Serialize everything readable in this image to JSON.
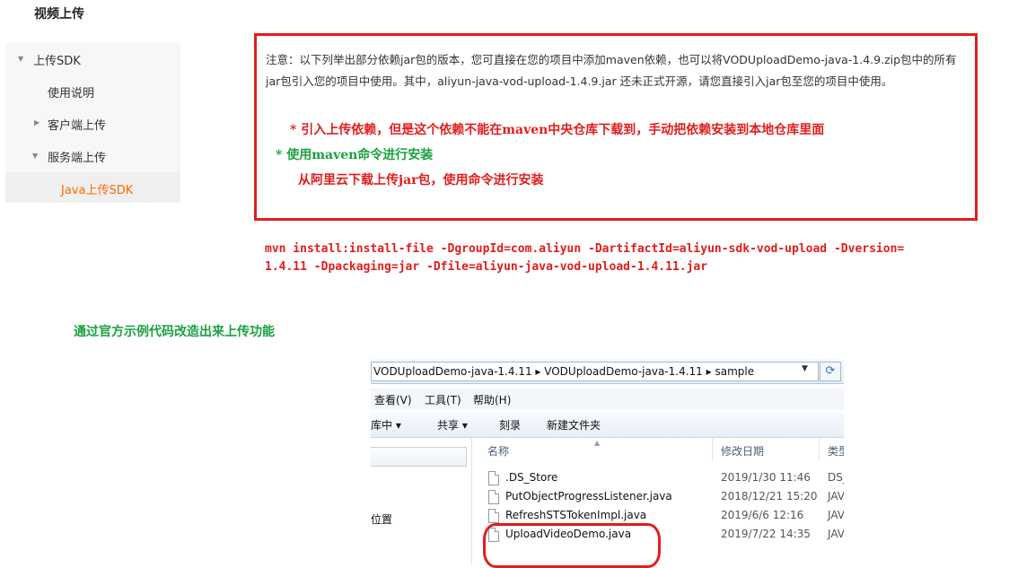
{
  "page_title": "视频上传",
  "sidebar": {
    "items": [
      {
        "label": "上传SDK"
      },
      {
        "label": "使用说明"
      },
      {
        "label": "客户端上传"
      },
      {
        "label": "服务端上传"
      },
      {
        "label": "Java上传SDK"
      }
    ]
  },
  "notice": {
    "text": "注意：以下列举出部分依赖jar包的版本，您可直接在您的项目中添加maven依赖，也可以将VODUploadDemo-java-1.4.9.zip包中的所有jar包引入您的项目中使用。其中，aliyun-java-vod-upload-1.4.9.jar 还未正式开源，请您直接引入jar包至您的项目中使用。",
    "annotation1": "* 引入上传依赖，但是这个依赖不能在maven中央仓库下载到，手动把依赖安装到本地仓库里面",
    "annotation2": "* 使用maven命令进行安装",
    "annotation3": "从阿里云下载上传jar包，使用命令进行安装"
  },
  "mvn_command": {
    "line1": "mvn install:install-file -DgroupId=com.aliyun -DartifactId=aliyun-sdk-vod-upload -Dversion=",
    "line2": "1.4.11 -Dpackaging=jar -Dfile=aliyun-java-vod-upload-1.4.11.jar"
  },
  "section_label": "通过官方示例代码改造出来上传功能",
  "explorer": {
    "address": "VODUploadDemo-java-1.4.11  ▸  VODUploadDemo-java-1.4.11  ▸  sample",
    "menu": [
      "查看(V)",
      "工具(T)",
      "帮助(H)"
    ],
    "toolbar": [
      "到库中 ▾",
      "共享 ▾",
      "刻录",
      "新建文件夹"
    ],
    "nav_pane_label": "位置",
    "columns": [
      "名称",
      "修改日期",
      "类型"
    ],
    "files": [
      {
        "name": ".DS_Store",
        "date": "2019/1/30 11:46",
        "type": "DS_"
      },
      {
        "name": "PutObjectProgressListener.java",
        "date": "2018/12/21 15:20",
        "type": "JAV"
      },
      {
        "name": "RefreshSTSTokenImpl.java",
        "date": "2019/6/6 12:16",
        "type": "JAV"
      },
      {
        "name": "UploadVideoDemo.java",
        "date": "2019/7/22 14:35",
        "type": "JAV"
      }
    ]
  },
  "colors": {
    "accent_orange": "#ff6a00",
    "annotation_red": "#e11d1d",
    "annotation_green": "#1aa13f"
  },
  "icons": [
    "triangle-down-icon",
    "triangle-right-icon",
    "refresh-icon",
    "file-icon",
    "dropdown-icon"
  ]
}
